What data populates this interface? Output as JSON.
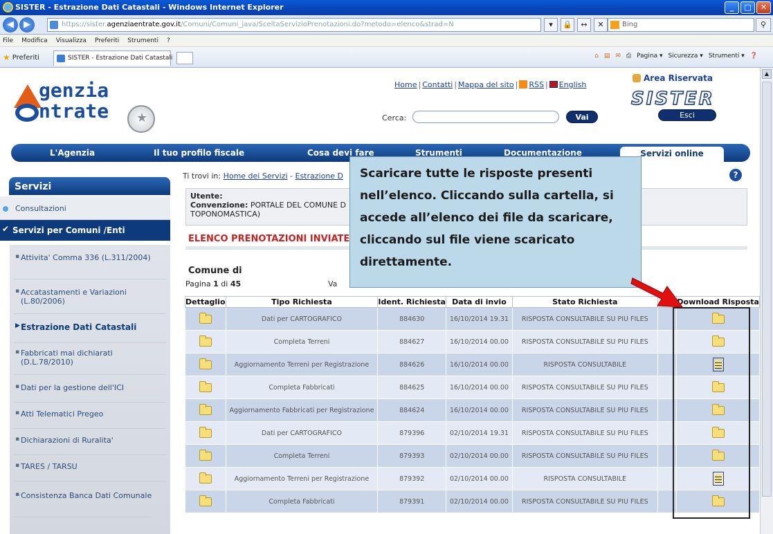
{
  "window": {
    "title": "SISTER - Estrazione Dati Catastali - Windows Internet Explorer",
    "buttons": [
      "_",
      "□",
      "✕"
    ]
  },
  "address": {
    "back": "◀",
    "forward": "▶",
    "url_prefix": "https://sister.",
    "url_domain": "agenziaentrate.gov.it",
    "url_path": "/Comuni/Comuni_java/SceltaServizioPrenotazioni.do?metodo=elenco&strad=N",
    "tools": [
      "▾",
      "🔒",
      "↔",
      "✕"
    ],
    "search_placeholder": "Bing",
    "search_go": "⚲"
  },
  "menu": [
    "File",
    "Modifica",
    "Visualizza",
    "Preferiti",
    "Strumenti",
    "?"
  ],
  "favorites": {
    "label": "Preferiti",
    "tab_label": "SISTER - Estrazione Dati Catastali",
    "commands": [
      "Pagina ▾",
      "Sicurezza ▾",
      "Strumenti ▾"
    ]
  },
  "site": {
    "logo_line1": "genzia",
    "logo_line2": "ntrate",
    "top_links": [
      "Home",
      "Contatti",
      "Mappa del sito",
      "RSS",
      "English"
    ],
    "search_label": "Cerca:",
    "search_button": "Vai",
    "area_riservata": "Area Riservata",
    "sister": "SISTER",
    "logout": "Esci",
    "nav": [
      "L'Agenzia",
      "Il tuo profilo fiscale",
      "Cosa devi fare",
      "Strumenti",
      "Documentazione",
      "Servizi online"
    ]
  },
  "sidebar": {
    "title": "Servizi",
    "consultazioni": "Consultazioni",
    "servizi_comuni": "Servizi per Comuni /Enti",
    "items": [
      "Attivita' Comma 336 (L.311/2004)",
      "Accatastamenti e Variazioni (L.80/2006)",
      "Estrazione Dati Catastali",
      "Fabbricati mai dichiarati (D.L.78/2010)",
      "Dati per la gestione dell'ICI",
      "Atti Telematici Pregeo",
      "Dichiarazioni di Ruralita'",
      "TARES / TARSU",
      "Consistenza Banca Dati Comunale"
    ]
  },
  "main": {
    "breadcrumb_prefix": "Ti trovi in:",
    "breadcrumb_home": "Home dei Servizi",
    "breadcrumb_sep": "-",
    "breadcrumb_current": "Estrazione D",
    "help": "?",
    "user_label": "Utente:",
    "convenzione_label": "Convenzione:",
    "convenzione_value": "PORTALE DEL COMUNE D",
    "convenzione_line2": "TOPONOMASTICA)",
    "list_title": "ELENCO PRENOTAZIONI INVIATE",
    "comune_label": "Comune di",
    "page_label": "Pagina",
    "page_current": "1",
    "page_of": "di",
    "page_total": "45",
    "vai_label": "Va"
  },
  "table": {
    "headers": [
      "Dettaglio",
      "Tipo Richiesta",
      "Ident. Richiesta",
      "Data di invio",
      "Stato Richiesta",
      "",
      "Download Risposta"
    ],
    "rows": [
      {
        "tipo": "Dati per CARTOGRAFICO",
        "id": "884630",
        "data": "16/10/2014 19.31",
        "stato": "RISPOSTA CONSULTABILE SU PIU FILES",
        "download": "folder"
      },
      {
        "tipo": "Completa Terreni",
        "id": "884627",
        "data": "16/10/2014 00.00",
        "stato": "RISPOSTA CONSULTABILE SU PIU FILES",
        "download": "folder"
      },
      {
        "tipo": "Aggiornamento Terreni per Registrazione",
        "id": "884626",
        "data": "16/10/2014 00.00",
        "stato": "RISPOSTA CONSULTABILE",
        "download": "file"
      },
      {
        "tipo": "Completa Fabbricati",
        "id": "884625",
        "data": "16/10/2014 00.00",
        "stato": "RISPOSTA CONSULTABILE SU PIU FILES",
        "download": "folder"
      },
      {
        "tipo": "Aggiornamento Fabbricati per Registrazione",
        "id": "884624",
        "data": "16/10/2014 00.00",
        "stato": "RISPOSTA CONSULTABILE SU PIU FILES",
        "download": "folder"
      },
      {
        "tipo": "Dati per CARTOGRAFICO",
        "id": "879396",
        "data": "02/10/2014 19.31",
        "stato": "RISPOSTA CONSULTABILE SU PIU FILES",
        "download": "folder"
      },
      {
        "tipo": "Completa Terreni",
        "id": "879393",
        "data": "02/10/2014 00.00",
        "stato": "RISPOSTA CONSULTABILE SU PIU FILES",
        "download": "folder"
      },
      {
        "tipo": "Aggiornamento Terreni per Registrazione",
        "id": "879392",
        "data": "02/10/2014 00.00",
        "stato": "RISPOSTA CONSULTABILE",
        "download": "file"
      },
      {
        "tipo": "Completa Fabbricati",
        "id": "879391",
        "data": "02/10/2014 00.00",
        "stato": "RISPOSTA CONSULTABILE SU PIU FILES",
        "download": "folder"
      }
    ]
  },
  "callout": {
    "text": "Scaricare tutte le risposte presenti nell’elenco. Cliccando sulla cartella, si accede all’elenco dei file da scaricare, cliccando sul file viene scaricato direttamente."
  },
  "colors": {
    "brand_blue": "#0d3a7a",
    "title_red": "#c42323",
    "callout_bg": "#bcd9ea",
    "arrow_red": "#e01010",
    "download_bg": "#fbf7a8"
  }
}
